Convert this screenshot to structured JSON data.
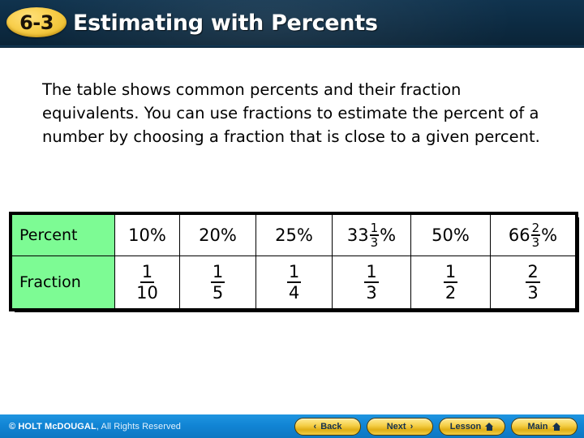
{
  "header": {
    "badge": "6-3",
    "title": "Estimating with Percents"
  },
  "main": {
    "paragraph": "The table shows common percents and their fraction equivalents. You can use fractions to estimate the percent of a number by choosing a fraction that is close to a given percent."
  },
  "table": {
    "row_labels": {
      "percent": "Percent",
      "fraction": "Fraction"
    },
    "percents": [
      {
        "type": "plain",
        "text": "10%"
      },
      {
        "type": "plain",
        "text": "20%"
      },
      {
        "type": "plain",
        "text": "25%"
      },
      {
        "type": "mixed",
        "whole": "33",
        "num": "1",
        "den": "3",
        "suffix": "%"
      },
      {
        "type": "plain",
        "text": "50%"
      },
      {
        "type": "mixed",
        "whole": "66",
        "num": "2",
        "den": "3",
        "suffix": "%"
      }
    ],
    "fractions": [
      {
        "num": "1",
        "den": "10"
      },
      {
        "num": "1",
        "den": "5"
      },
      {
        "num": "1",
        "den": "4"
      },
      {
        "num": "1",
        "den": "3"
      },
      {
        "num": "1",
        "den": "2"
      },
      {
        "num": "2",
        "den": "3"
      }
    ]
  },
  "footer": {
    "copyright_symbol": "©",
    "copyright_strong": "HOLT McDOUGAL",
    "copyright_light": ", All Rights Reserved",
    "buttons": [
      {
        "label": "Back",
        "icon": "chevron-left-icon",
        "glyph": "‹"
      },
      {
        "label": "Next",
        "icon": "chevron-right-icon",
        "glyph": "›"
      },
      {
        "label": "Lesson",
        "icon": "home-icon",
        "glyph": ""
      },
      {
        "label": "Main",
        "icon": "home-icon",
        "glyph": ""
      }
    ]
  },
  "colors": {
    "header_navy": "#0d2c44",
    "badge_gold": "#f8cf4d",
    "table_header_green": "#7dfb94",
    "footer_blue": "#1184d4",
    "button_gold": "#f5d04a"
  }
}
